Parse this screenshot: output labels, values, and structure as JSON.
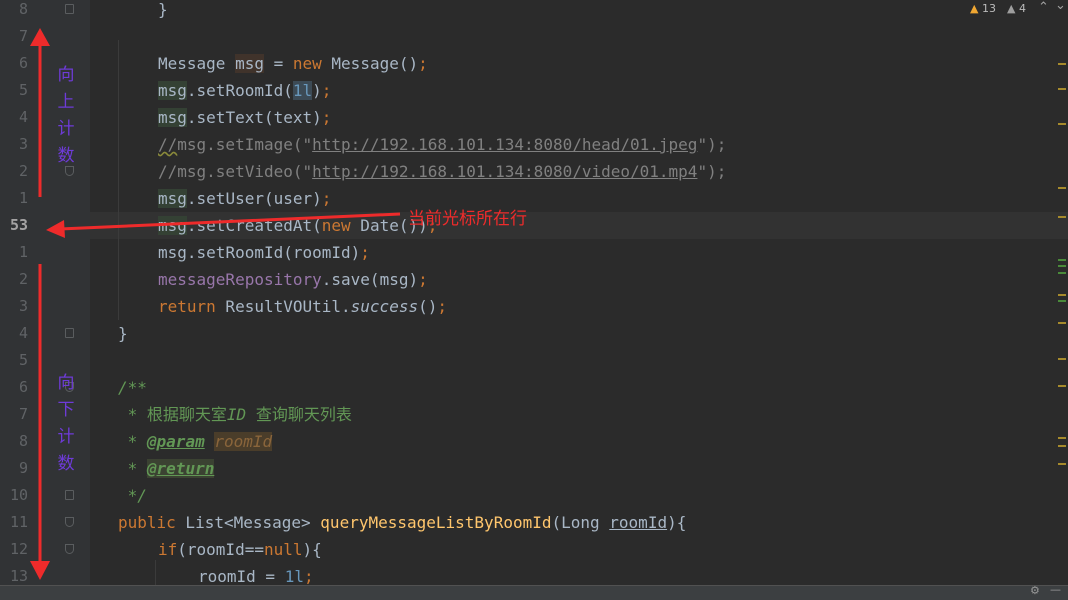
{
  "gutter": {
    "line_numbers": [
      "8",
      "7",
      "6",
      "5",
      "4",
      "3",
      "2",
      "1",
      "53",
      "1",
      "2",
      "3",
      "4",
      "5",
      "6",
      "7",
      "8",
      "9",
      "10",
      "11",
      "12",
      "13"
    ]
  },
  "code": {
    "l0": "}",
    "l2_a": "Message ",
    "l2_b": "msg",
    "l2_c": " = ",
    "l2_d": "new",
    "l2_e": " Message()",
    "l2_f": ";",
    "l3_a": "msg",
    "l3_b": ".setRoomId(",
    "l3_c": "1l",
    "l3_d": ")",
    "l3_e": ";",
    "l4_a": "msg",
    "l4_b": ".setText(text)",
    "l4_c": ";",
    "l5_a": "//",
    "l5_b": "msg.setImage(\"",
    "l5_c": "http://192.168.101.134:8080/head/01.jpeg",
    "l5_d": "\");",
    "l6_a": "//msg.setVideo(\"",
    "l6_b": "http://192.168.101.134:8080/video/01.mp4",
    "l6_c": "\");",
    "l7_a": "msg",
    "l7_b": ".setUser(user)",
    "l7_c": ";",
    "l8_a": "msg",
    "l8_b": ".setCreatedAt(",
    "l8_c": "new",
    "l8_d": " Date())",
    "l8_e": ";",
    "l9_a": "msg",
    "l9_b": ".setRoomId(roomId)",
    "l9_c": ";",
    "l10_a": "messageRepository",
    "l10_b": ".save(",
    "l10_c": "msg",
    "l10_d": ")",
    "l10_e": ";",
    "l11_a": "return",
    "l11_b": " ResultVOUtil.",
    "l11_c": "success",
    "l11_d": "()",
    "l11_e": ";",
    "l12": "}",
    "l14": "/**",
    "l15_a": " * ",
    "l15_b": "根据聊天室",
    "l15_c": "ID",
    "l15_d": " 查询聊天列表",
    "l16_a": " * ",
    "l16_b": "@param",
    "l16_c": " ",
    "l16_d": "roomId",
    "l17_a": " * ",
    "l17_b": "@return",
    "l18": " */",
    "l19_a": "public",
    "l19_b": " List<Message> ",
    "l19_c": "queryMessageListByRoomId",
    "l19_d": "(Long ",
    "l19_e": "roomId",
    "l19_f": "){",
    "l20_a": "if",
    "l20_b": "(roomId==",
    "l20_c": "null",
    "l20_d": "){",
    "l21_a": "roomId = ",
    "l21_b": "1l",
    "l21_c": ";"
  },
  "inspections": {
    "warnings": "13",
    "weak_warnings": "4"
  },
  "annotations": {
    "up_label": [
      "向",
      "上",
      "计",
      "数"
    ],
    "down_label": [
      "向",
      "下",
      "计",
      "数"
    ],
    "cursor_label": "当前光标所在行"
  },
  "colors": {
    "arrow": "#ee2b2b",
    "annotation_text": "#6e3bd8"
  }
}
